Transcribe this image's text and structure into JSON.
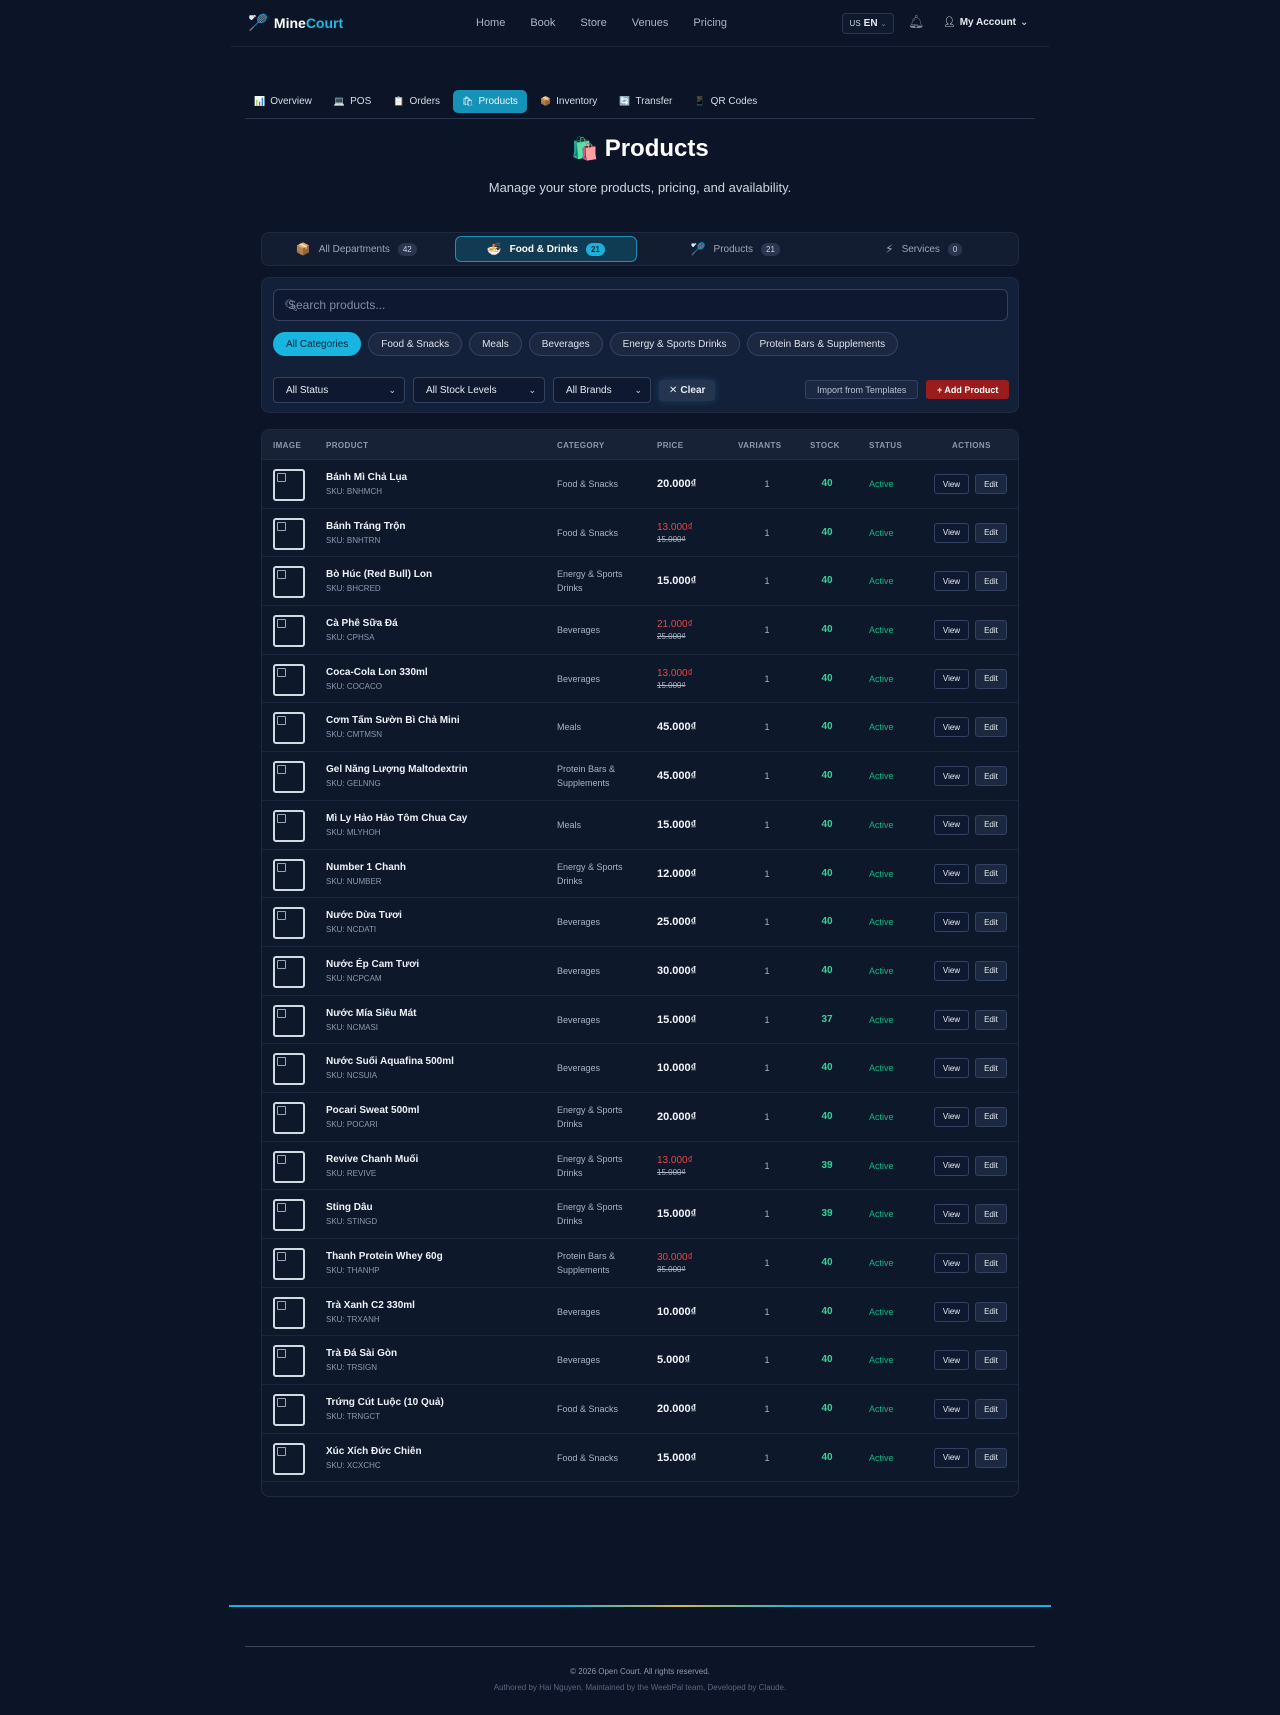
{
  "brand": {
    "name_part1": "Mine",
    "name_part2": "Court"
  },
  "topnav": [
    "Home",
    "Book",
    "Store",
    "Venues",
    "Pricing"
  ],
  "lang": {
    "flag": "US",
    "code": "EN"
  },
  "account": {
    "label": "My Account"
  },
  "subtabs": [
    {
      "label": "Overview",
      "icon": "📊"
    },
    {
      "label": "POS",
      "icon": "💻"
    },
    {
      "label": "Orders",
      "icon": "📋"
    },
    {
      "label": "Products",
      "icon": "🛍",
      "active": true
    },
    {
      "label": "Inventory",
      "icon": "📦"
    },
    {
      "label": "Transfer",
      "icon": "🔄"
    },
    {
      "label": "QR Codes",
      "icon": "📱"
    }
  ],
  "page": {
    "title": "Products",
    "title_icon": "🛍️",
    "subtitle": "Manage your store products, pricing, and availability."
  },
  "departments": [
    {
      "label": "All Departments",
      "count": "42",
      "icon": "📦"
    },
    {
      "label": "Food & Drinks",
      "count": "21",
      "icon": "🍜",
      "active": true
    },
    {
      "label": "Products",
      "count": "21",
      "icon": "🏸"
    },
    {
      "label": "Services",
      "count": "0",
      "icon": "⚡"
    }
  ],
  "search": {
    "placeholder": "Search products..."
  },
  "categories": [
    {
      "label": "All Categories",
      "active": true
    },
    {
      "label": "Food & Snacks"
    },
    {
      "label": "Meals"
    },
    {
      "label": "Beverages"
    },
    {
      "label": "Energy & Sports Drinks"
    },
    {
      "label": "Protein Bars & Supplements"
    }
  ],
  "filters": {
    "status": "All Status",
    "stock": "All Stock Levels",
    "brands": "All Brands",
    "clear": "Clear",
    "import": "Import from Templates",
    "add": "+ Add Product"
  },
  "table": {
    "headers": [
      "IMAGE",
      "PRODUCT",
      "CATEGORY",
      "PRICE",
      "VARIANTS",
      "STOCK",
      "STATUS",
      "ACTIONS"
    ],
    "view_label": "View",
    "edit_label": "Edit",
    "rows": [
      {
        "name": "Bánh Mì Chả Lụa",
        "sku": "SKU: BNHMCH",
        "category": "Food & Snacks",
        "price": "20.000₫",
        "old": "",
        "variants": "1",
        "stock": "40",
        "status": "Active"
      },
      {
        "name": "Bánh Tráng Trộn",
        "sku": "SKU: BNHTRN",
        "category": "Food & Snacks",
        "price": "13.000₫",
        "old": "15.000₫",
        "variants": "1",
        "stock": "40",
        "status": "Active"
      },
      {
        "name": "Bò Húc (Red Bull) Lon",
        "sku": "SKU: BHCRED",
        "category": "Energy & Sports Drinks",
        "price": "15.000₫",
        "old": "",
        "variants": "1",
        "stock": "40",
        "status": "Active"
      },
      {
        "name": "Cà Phê Sữa Đá",
        "sku": "SKU: CPHSA",
        "category": "Beverages",
        "price": "21.000₫",
        "old": "25.000₫",
        "variants": "1",
        "stock": "40",
        "status": "Active"
      },
      {
        "name": "Coca-Cola Lon 330ml",
        "sku": "SKU: COCACO",
        "category": "Beverages",
        "price": "13.000₫",
        "old": "15.000₫",
        "variants": "1",
        "stock": "40",
        "status": "Active"
      },
      {
        "name": "Cơm Tấm Sườn Bì Chả Mini",
        "sku": "SKU: CMTMSN",
        "category": "Meals",
        "price": "45.000₫",
        "old": "",
        "variants": "1",
        "stock": "40",
        "status": "Active"
      },
      {
        "name": "Gel Năng Lượng Maltodextrin",
        "sku": "SKU: GELNNG",
        "category": "Protein Bars & Supplements",
        "price": "45.000₫",
        "old": "",
        "variants": "1",
        "stock": "40",
        "status": "Active"
      },
      {
        "name": "Mì Ly Hảo Hảo Tôm Chua Cay",
        "sku": "SKU: MLYHOH",
        "category": "Meals",
        "price": "15.000₫",
        "old": "",
        "variants": "1",
        "stock": "40",
        "status": "Active"
      },
      {
        "name": "Number 1 Chanh",
        "sku": "SKU: NUMBER",
        "category": "Energy & Sports Drinks",
        "price": "12.000₫",
        "old": "",
        "variants": "1",
        "stock": "40",
        "status": "Active"
      },
      {
        "name": "Nước Dừa Tươi",
        "sku": "SKU: NCDATI",
        "category": "Beverages",
        "price": "25.000₫",
        "old": "",
        "variants": "1",
        "stock": "40",
        "status": "Active"
      },
      {
        "name": "Nước Ép Cam Tươi",
        "sku": "SKU: NCPCAM",
        "category": "Beverages",
        "price": "30.000₫",
        "old": "",
        "variants": "1",
        "stock": "40",
        "status": "Active"
      },
      {
        "name": "Nước Mía Siêu Mát",
        "sku": "SKU: NCMASI",
        "category": "Beverages",
        "price": "15.000₫",
        "old": "",
        "variants": "1",
        "stock": "37",
        "status": "Active"
      },
      {
        "name": "Nước Suối Aquafina 500ml",
        "sku": "SKU: NCSUIA",
        "category": "Beverages",
        "price": "10.000₫",
        "old": "",
        "variants": "1",
        "stock": "40",
        "status": "Active"
      },
      {
        "name": "Pocari Sweat 500ml",
        "sku": "SKU: POCARI",
        "category": "Energy & Sports Drinks",
        "price": "20.000₫",
        "old": "",
        "variants": "1",
        "stock": "40",
        "status": "Active"
      },
      {
        "name": "Revive Chanh Muối",
        "sku": "SKU: REVIVE",
        "category": "Energy & Sports Drinks",
        "price": "13.000₫",
        "old": "15.000₫",
        "variants": "1",
        "stock": "39",
        "status": "Active"
      },
      {
        "name": "Sting Dâu",
        "sku": "SKU: STINGD",
        "category": "Energy & Sports Drinks",
        "price": "15.000₫",
        "old": "",
        "variants": "1",
        "stock": "39",
        "status": "Active"
      },
      {
        "name": "Thanh Protein Whey 60g",
        "sku": "SKU: THANHP",
        "category": "Protein Bars & Supplements",
        "price": "30.000₫",
        "old": "35.000₫",
        "variants": "1",
        "stock": "40",
        "status": "Active"
      },
      {
        "name": "Trà Xanh C2 330ml",
        "sku": "SKU: TRXANH",
        "category": "Beverages",
        "price": "10.000₫",
        "old": "",
        "variants": "1",
        "stock": "40",
        "status": "Active"
      },
      {
        "name": "Trà Đá Sài Gòn",
        "sku": "SKU: TRSIGN",
        "category": "Beverages",
        "price": "5.000₫",
        "old": "",
        "variants": "1",
        "stock": "40",
        "status": "Active"
      },
      {
        "name": "Trứng Cút Luộc (10 Quả)",
        "sku": "SKU: TRNGCT",
        "category": "Food & Snacks",
        "price": "20.000₫",
        "old": "",
        "variants": "1",
        "stock": "40",
        "status": "Active"
      },
      {
        "name": "Xúc Xích Đức Chiên",
        "sku": "SKU: XCXCHC",
        "category": "Food & Snacks",
        "price": "15.000₫",
        "old": "",
        "variants": "1",
        "stock": "40",
        "status": "Active"
      }
    ]
  },
  "footer": {
    "copyright": "© 2026 Open Court. All rights reserved.",
    "authored": "Authored by Hai Nguyen, Maintained by the WeebPal team, Developed by Claude."
  },
  "colors": {
    "accent": "#1ab2dc",
    "danger": "#9b1c1c",
    "success": "#34d399",
    "background": "#0c1527"
  }
}
